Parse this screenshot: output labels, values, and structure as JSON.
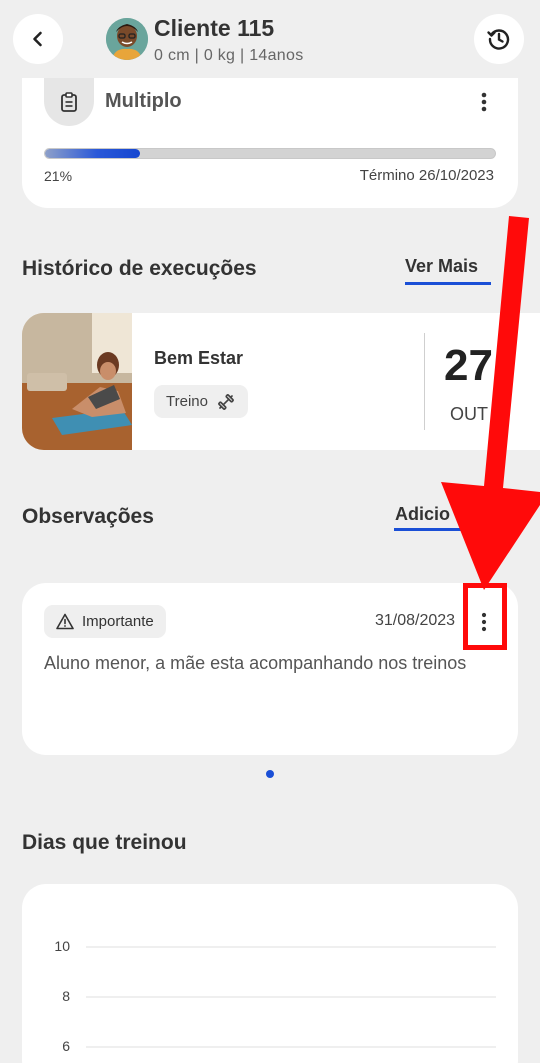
{
  "header": {
    "client_name": "Cliente 115",
    "client_meta": "0 cm |  0 kg |  14anos",
    "back_icon": "chevron-left-icon",
    "history_icon": "history-icon"
  },
  "plan": {
    "name": "Multiplo",
    "icon": "clipboard-icon",
    "progress_label": "21%",
    "progress_value": 0.21,
    "end_label": "Término 26/10/2023"
  },
  "executions": {
    "title": "Histórico de execuções",
    "link": "Ver Mais",
    "items": [
      {
        "title": "Bem Estar",
        "chip": "Treino",
        "day": "27",
        "month": "OUT"
      }
    ]
  },
  "observations": {
    "title": "Observações",
    "link": "Adicio",
    "items": [
      {
        "tag": "Importante",
        "date": "31/08/2023",
        "text": "Aluno menor, a mãe esta acompanhando nos treinos"
      }
    ]
  },
  "trained_days": {
    "title": "Dias que treinou"
  },
  "chart_data": {
    "type": "bar",
    "title": "",
    "yticks": [
      "10",
      "8",
      "6"
    ],
    "ylim": [
      6,
      10
    ],
    "grid": true
  },
  "colors": {
    "accent": "#1a4fd6",
    "annotation": "#ff0a0a",
    "background": "#efefef"
  }
}
